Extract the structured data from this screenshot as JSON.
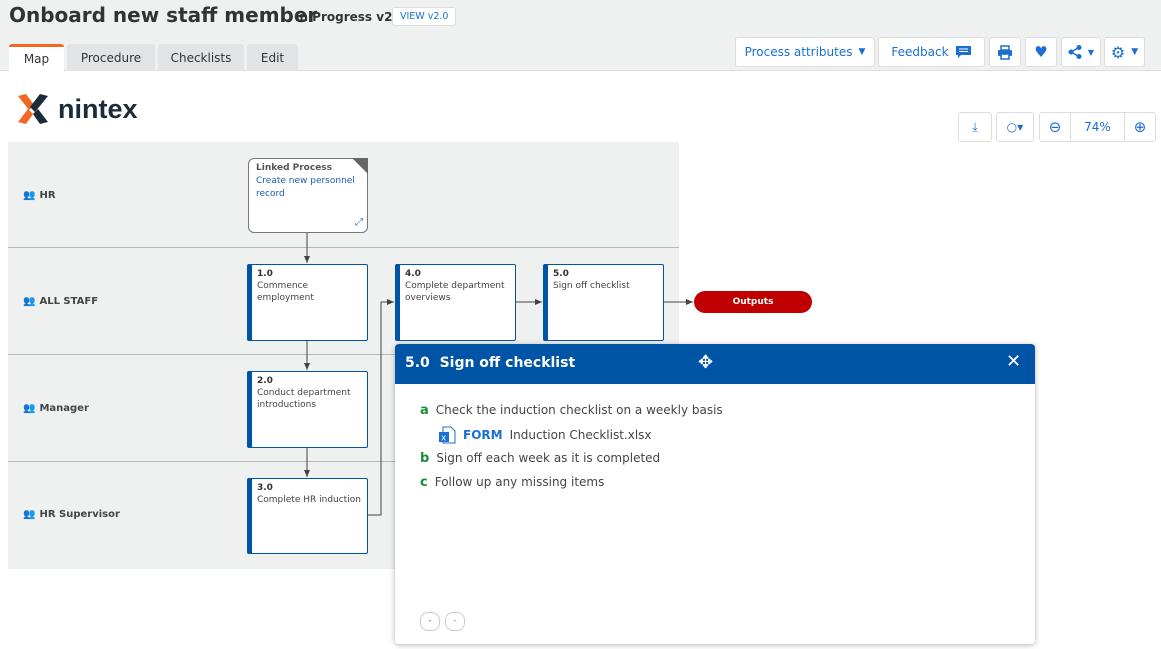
{
  "header": {
    "title": "Onboard new staff member",
    "status": "In Progress v2.2",
    "view_button": "VIEW v2.0"
  },
  "tabs": [
    {
      "label": "Map",
      "active": true
    },
    {
      "label": "Procedure"
    },
    {
      "label": "Checklists"
    },
    {
      "label": "Edit"
    }
  ],
  "toolbar": {
    "process_attributes": "Process attributes",
    "feedback": "Feedback",
    "icons": [
      "print-icon",
      "heart-icon",
      "share-icon",
      "gear-icon"
    ]
  },
  "logo": {
    "text": "nintex",
    "colors": [
      "#f26722",
      "#1c2b39"
    ]
  },
  "map_controls": {
    "zoom": "74%"
  },
  "lanes": [
    {
      "label": "HR"
    },
    {
      "label": "ALL STAFF"
    },
    {
      "label": "Manager"
    },
    {
      "label": "HR Supervisor"
    }
  ],
  "linked_process": {
    "heading": "Linked Process",
    "name": "Create new personnel record"
  },
  "activities": [
    {
      "num": "1.0",
      "label": "Commence employment"
    },
    {
      "num": "2.0",
      "label": "Conduct department introductions"
    },
    {
      "num": "3.0",
      "label": "Complete HR induction"
    },
    {
      "num": "4.0",
      "label": "Complete department overviews"
    },
    {
      "num": "5.0",
      "label": "Sign off checklist"
    }
  ],
  "outputs": "Outputs",
  "popup": {
    "num": "5.0",
    "title": "Sign off checklist",
    "steps": [
      {
        "letter": "a",
        "text": "Check the induction checklist on a weekly basis"
      },
      {
        "letter": "b",
        "text": "Sign off each week as it is completed"
      },
      {
        "letter": "c",
        "text": "Follow up any missing items"
      }
    ],
    "attachment": {
      "type": "FORM",
      "name": "Induction Checklist.xlsx"
    },
    "buttons": [
      "-",
      "-"
    ]
  },
  "colors": {
    "accent": "#1a6fd1",
    "brand_blue": "#0054a6",
    "tab_active": "#f26722",
    "outputs": "#c00000",
    "step_letter": "#1a8f3a"
  }
}
